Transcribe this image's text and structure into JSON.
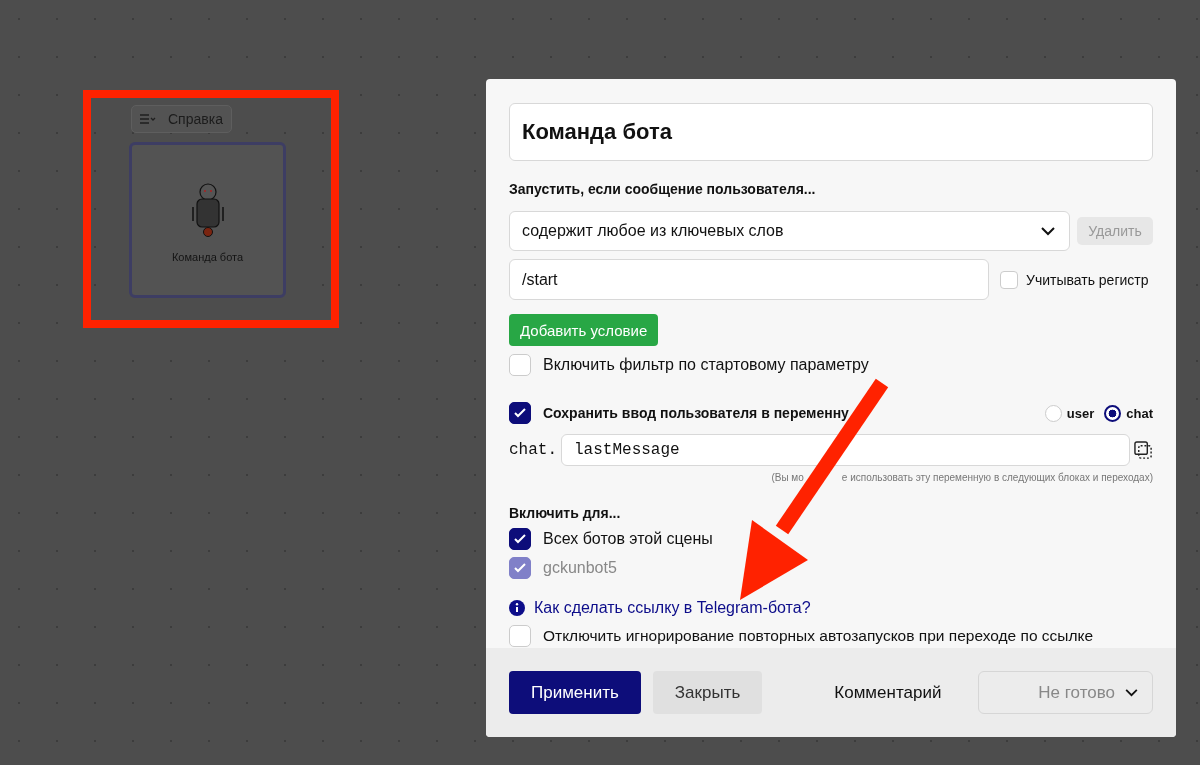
{
  "canvas": {
    "node": {
      "menu_label": "Справка",
      "title": "Команда бота"
    }
  },
  "dialog": {
    "title": "Команда бота",
    "trigger_label": "Запустить, если сообщение пользователя...",
    "condition": {
      "value": "содержит любое из ключевых слов",
      "delete_button": "Удалить"
    },
    "keyword": {
      "value": "/start",
      "case_sensitive": {
        "label": "Учитывать регистр",
        "checked": false
      }
    },
    "add_condition_button": "Добавить условие",
    "start_param_filter": {
      "label": "Включить фильтр по стартовому параметру",
      "checked": false
    },
    "save_input": {
      "label": "Сохранить ввод пользователя в переменну",
      "checked": true
    },
    "scope_options": [
      {
        "label": "user",
        "selected": false
      },
      {
        "label": "chat",
        "selected": true
      }
    ],
    "variable": {
      "prefix": "chat.",
      "value": "lastMessage",
      "hint_parts": [
        "(Вы мо",
        "е использовать эту переменную в следующих блоках и переходах)"
      ]
    },
    "enable_for_label": "Включить для...",
    "bots": [
      {
        "label": "Всех ботов этой сцены",
        "checked": true,
        "disabled": false
      },
      {
        "label": "gckunbot5",
        "checked": true,
        "disabled": true
      }
    ],
    "help_link": "Как сделать ссылку в Telegram-бота?",
    "ignore_repeat": {
      "label": "Отключить игнорирование повторных автозапусков при переходе по ссылке",
      "checked": false
    },
    "footer": {
      "apply_button": "Применить",
      "close_button": "Закрыть",
      "comment_button": "Комментарий",
      "status": "Не готово"
    }
  }
}
